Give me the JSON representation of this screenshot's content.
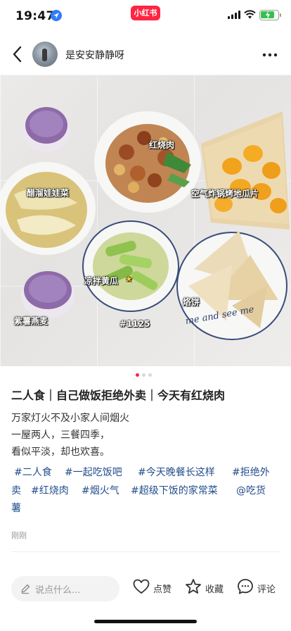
{
  "status_bar": {
    "time": "19:47",
    "app_badge": "小红书",
    "icons": [
      "location-arrow-icon",
      "signal-icon",
      "wifi-icon",
      "battery-icon"
    ],
    "battery_color": "#33c24d"
  },
  "nav": {
    "author_name": "是安安静静呀",
    "icons": [
      "back-arrow-icon",
      "more-icon"
    ]
  },
  "photo": {
    "labels": {
      "hongshaorou": "红烧肉",
      "baicai": "醋溜娃娃菜",
      "digua": "空气炸锅烤地瓜片",
      "huanggua": "凉拌黄瓜",
      "hashtag": "#1125",
      "yanmai": "紫薯燕麦",
      "laobing": "烙饼",
      "plate_text": "me and see me"
    },
    "page_count": 3,
    "active_page": 1
  },
  "post": {
    "title": "二人食｜自己做饭拒绝外卖｜今天有红烧肉",
    "lines": [
      "万家灯火不及小家人间烟火",
      "一屋两人，三餐四季，",
      "看似平淡，却也欢喜。"
    ],
    "tags": [
      "#二人食",
      "#一起吃饭吧",
      "#今天晚餐长这样",
      "#拒绝外",
      "卖",
      "#红烧肉",
      "#烟火气",
      "#超级下饭的家常菜",
      "@吃货",
      "薯"
    ],
    "time": "刚刚",
    "tag_color": "#234e8c"
  },
  "bottom_bar": {
    "comment_placeholder": "说点什么...",
    "like_label": "点赞",
    "collect_label": "收藏",
    "comment_label": "评论"
  },
  "colors": {
    "brand": "#ff2442",
    "tag": "#234e8c"
  }
}
